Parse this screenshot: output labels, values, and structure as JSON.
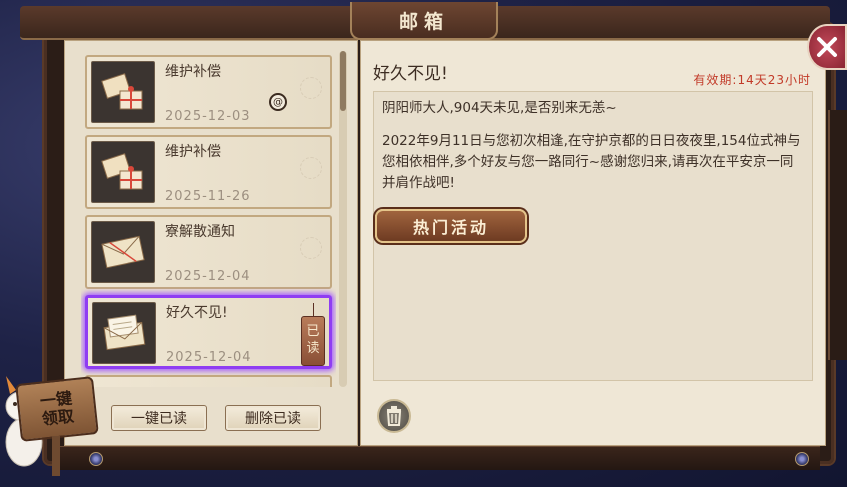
{
  "window": {
    "title": "邮箱"
  },
  "mail_list": [
    {
      "title": "维护补偿",
      "date": "2025-12-03",
      "icon": "gift-box-icon",
      "selected": false
    },
    {
      "title": "维护补偿",
      "date": "2025-11-26",
      "icon": "gift-box-icon",
      "selected": false
    },
    {
      "title": "寮解散通知",
      "date": "2025-12-04",
      "icon": "envelope-icon",
      "selected": false
    },
    {
      "title": "好久不见!",
      "date": "2025-12-04",
      "icon": "open-letter-icon",
      "selected": true,
      "tag": "已读"
    }
  ],
  "list_actions": {
    "mark_all_read": "一键已读",
    "delete_read": "删除已读"
  },
  "collect_all": {
    "label_line1": "一键",
    "label_line2": "领取"
  },
  "detail": {
    "title": "好久不见!",
    "validity": "有效期:14天23小时",
    "paragraphs": [
      "阴阳师大人,904天未见,是否别来无恙~",
      "2022年9月11日与您初次相逢,在守护京都的日日夜夜里,154位式神与您相依相伴,多个好友与您一路同行~感谢您归来,请再次在平安京一同并肩作战吧!"
    ],
    "action_button": "热门活动"
  },
  "colors": {
    "selected_border": "#8f3df2",
    "validity_text": "#c23a28",
    "close_button": "#c24a5a"
  }
}
